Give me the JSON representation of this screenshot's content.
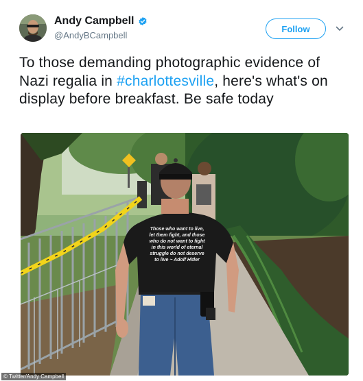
{
  "author": {
    "name": "Andy Campbell",
    "handle": "@AndyBCampbell",
    "verified": true
  },
  "follow_button": {
    "label": "Follow"
  },
  "tweet": {
    "text_before": "To those demanding photographic evidence of Nazi regalia in ",
    "hashtag": "#charlottesville",
    "text_after": ", here's what's on display before breakfast. Be safe today"
  },
  "photo": {
    "shirt_lines": [
      "Those who want to live,",
      "let them fight, and those",
      "who do not want to fight",
      "in this world of eternal",
      "struggle do not deserve",
      "to live ~ Adolf Hitler"
    ]
  },
  "credit": "© Twitter/Andy Campbell",
  "colors": {
    "accent": "#1da1f2",
    "text": "#14171a",
    "muted": "#657786",
    "police_tape": "#f2d41a"
  },
  "icons": {
    "verified": "verified-badge-icon",
    "caret": "chevron-down-icon"
  }
}
